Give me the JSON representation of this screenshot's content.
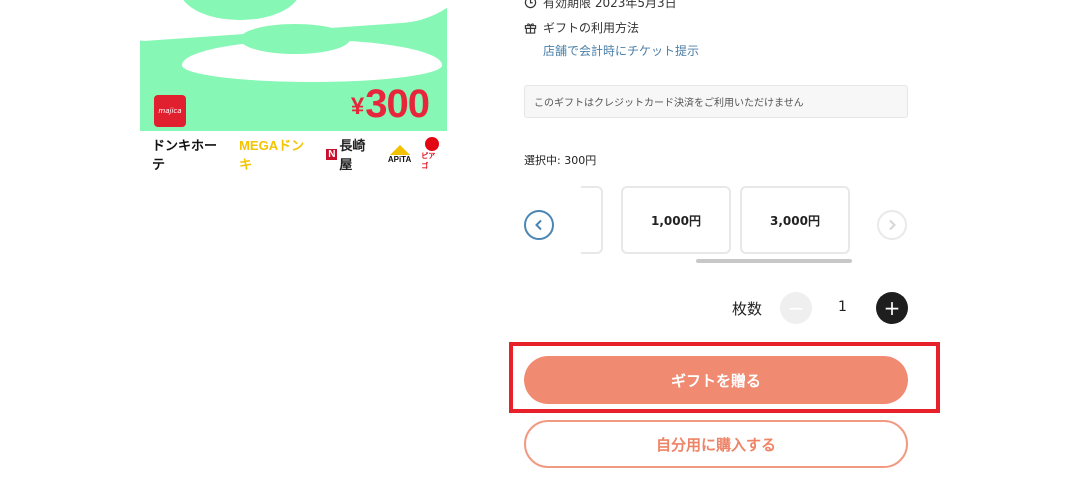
{
  "card": {
    "brand_mark": "majica",
    "currency_symbol": "¥",
    "amount": "300",
    "store_logos": {
      "donki": "ドンキホーテ",
      "mega": "MEGAドンキ",
      "nagasakiya_mark": "N",
      "nagasakiya": "長崎屋",
      "apita": "APiTA",
      "piago": "ピアゴ"
    }
  },
  "info": {
    "expiry": "有効期限 2023年5月3日",
    "usage_title": "ギフトの利用方法",
    "usage_link": "店舗で会計時にチケット提示",
    "notice": "このギフトはクレジットカード決済をご利用いただけません"
  },
  "selection": {
    "selected_text": "選択中: 300円",
    "amounts": [
      "",
      "1,000円",
      "3,000円"
    ],
    "prev_icon": "chevron-left-icon",
    "next_icon": "chevron-right-icon"
  },
  "quantity": {
    "label": "枚数",
    "value": "1",
    "minus": "−",
    "plus": "+"
  },
  "actions": {
    "gift_label": "ギフトを贈る",
    "self_label": "自分用に購入する"
  },
  "colors": {
    "card_bg": "#86f7b5",
    "price": "#e8263b",
    "primary_button": "#f08b72",
    "highlight": "#e8202a",
    "link": "#4a7fa8"
  }
}
